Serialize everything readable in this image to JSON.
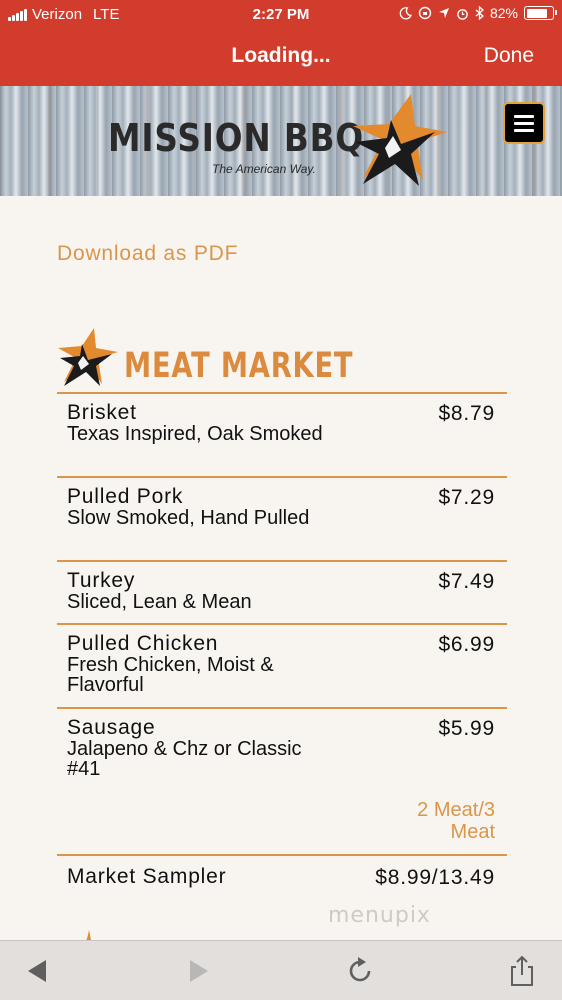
{
  "status_bar": {
    "carrier": "Verizon",
    "network": "LTE",
    "time": "2:27 PM",
    "battery": "82%",
    "battery_level": 0.82
  },
  "nav": {
    "title": "Loading...",
    "done_label": "Done"
  },
  "header": {
    "logo_text": "MISSION BBQ",
    "tagline": "The American Way."
  },
  "content": {
    "pdf_link": "Download as PDF",
    "section_title": "MEAT MARKET",
    "items": [
      {
        "name": "Brisket",
        "desc": "Texas Inspired, Oak Smoked",
        "price": "$8.79"
      },
      {
        "name": "Pulled Pork",
        "desc": "Slow Smoked, Hand Pulled",
        "price": "$7.29"
      },
      {
        "name": "Turkey",
        "desc": "Sliced, Lean & Mean",
        "price": "$7.49"
      },
      {
        "name": "Pulled Chicken",
        "desc": "Fresh Chicken, Moist & Flavorful",
        "price": "$6.99"
      },
      {
        "name": "Sausage",
        "desc": "Jalapeno & Chz or Classic #41",
        "price": "$5.99"
      }
    ],
    "note_line1": "2 Meat/3",
    "note_line2": "Meat",
    "sampler": {
      "name": "Market Sampler",
      "price": "$8.99/13.49"
    },
    "watermark": "menupix"
  },
  "colors": {
    "brand_red": "#d13c2c",
    "accent_orange": "#d9964a",
    "background": "#f8f5f1"
  },
  "toolbar": {
    "icons": [
      "back-arrow-icon",
      "forward-arrow-icon",
      "refresh-icon",
      "share-icon"
    ]
  }
}
